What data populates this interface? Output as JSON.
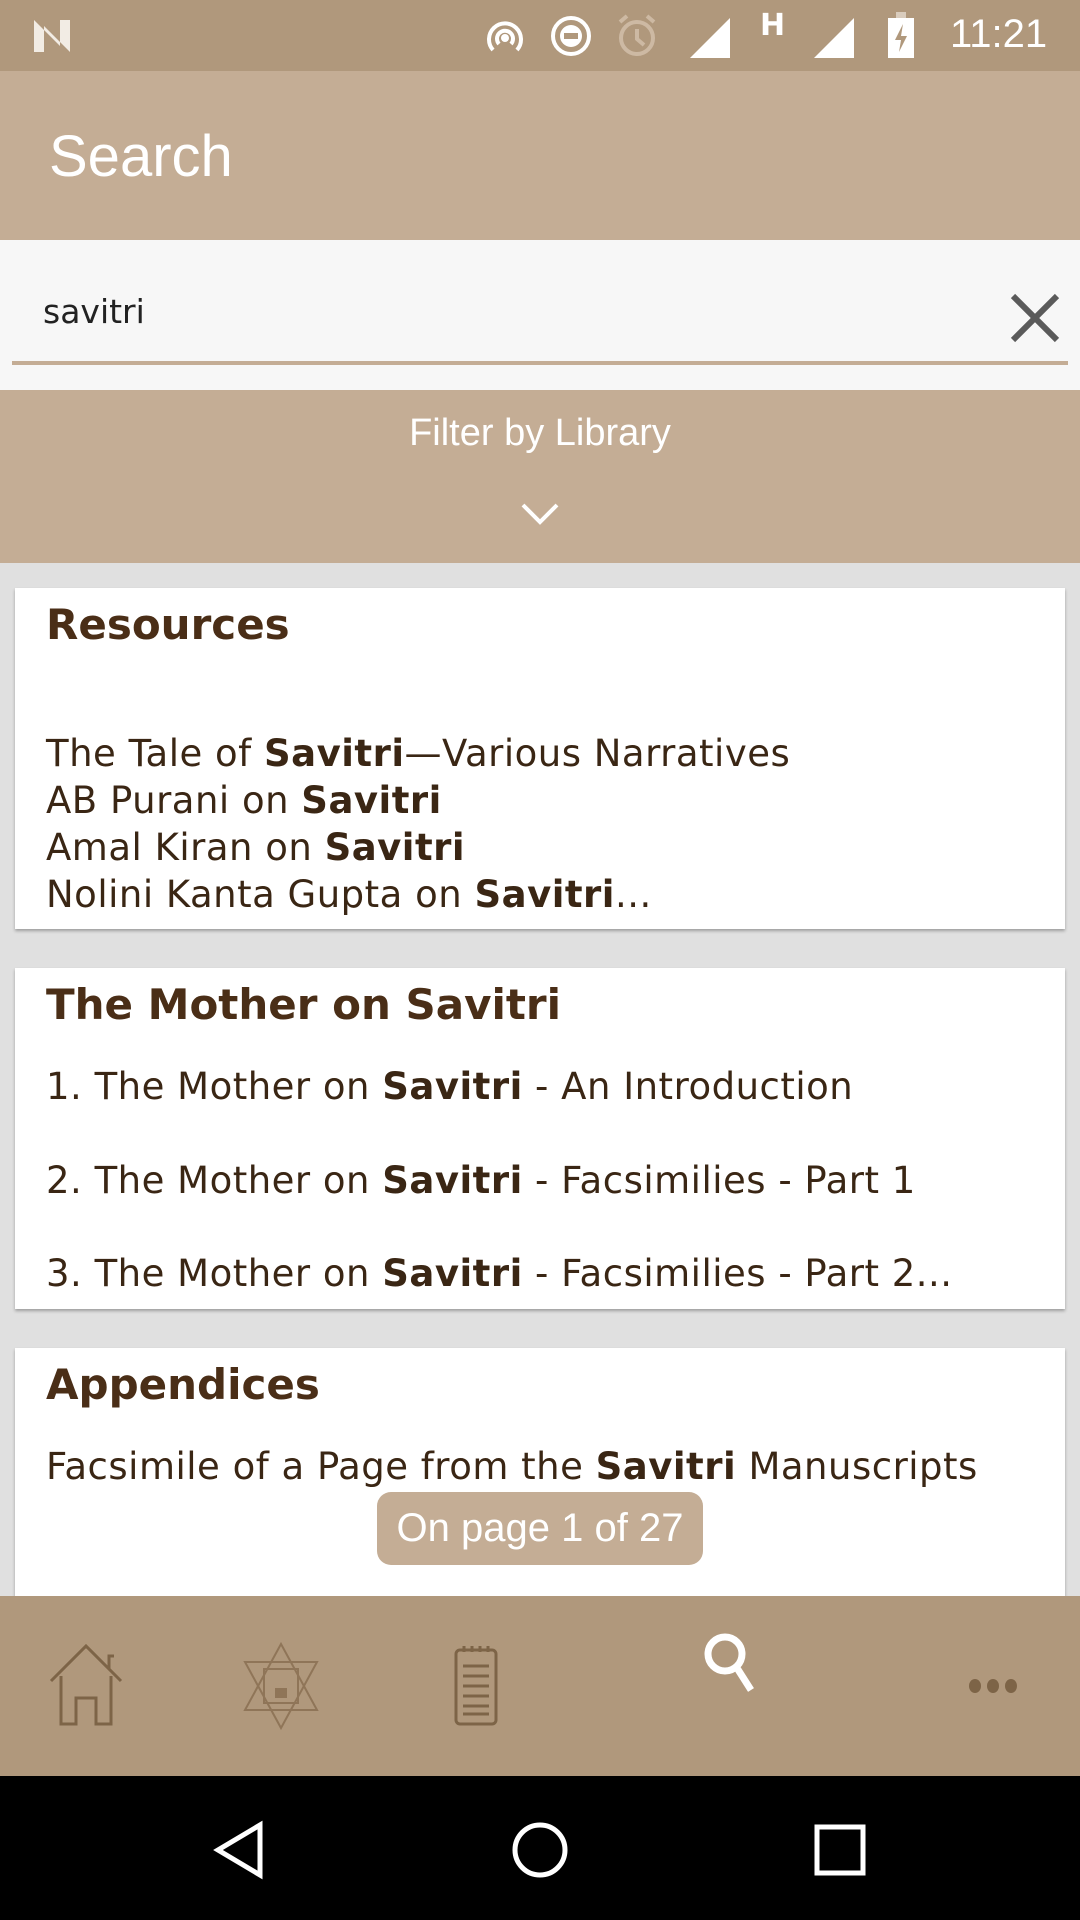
{
  "status_bar": {
    "time": "11:21",
    "network_label": "H",
    "icons": [
      "n-logo-icon",
      "hotspot-icon",
      "do-not-disturb-icon",
      "alarm-icon",
      "signal-icon",
      "signal-icon",
      "battery-charging-icon"
    ]
  },
  "app_bar": {
    "title": "Search"
  },
  "search": {
    "value": "savitri",
    "clear_icon": "close-icon"
  },
  "filter": {
    "label": "Filter by Library",
    "icon": "chevron-down-icon"
  },
  "results": [
    {
      "title": "Resources",
      "lines": [
        [
          "The Tale of ",
          "Savitri",
          "—Various Narratives"
        ],
        [
          "AB Purani on ",
          "Savitri",
          ""
        ],
        [
          "Amal Kiran on ",
          "Savitri",
          ""
        ],
        [
          "Nolini Kanta Gupta on ",
          "Savitri",
          "..."
        ]
      ]
    },
    {
      "title": "The Mother on Savitri",
      "lines": [
        [
          "1. The Mother on ",
          "Savitri",
          " - An Introduction"
        ],
        [
          "2. The Mother on ",
          "Savitri",
          " - Facsimilies - Part 1"
        ],
        [
          "3. The Mother on ",
          "Savitri",
          " - Facsimilies - Part 2..."
        ]
      ]
    },
    {
      "title": "Appendices",
      "lines": [
        [
          "Facsimile of a Page from the ",
          "Savitri",
          " Manuscripts"
        ]
      ]
    }
  ],
  "page_indicator": "On page 1 of 27",
  "bottom_nav": [
    {
      "icon": "home-icon"
    },
    {
      "icon": "star-emblem-icon"
    },
    {
      "icon": "notepad-icon"
    },
    {
      "icon": "search-icon",
      "active": true
    },
    {
      "icon": "more-icon"
    }
  ],
  "colors": {
    "primary": "#c4ad95",
    "dark": "#b0987c",
    "text": "#3a2614"
  }
}
